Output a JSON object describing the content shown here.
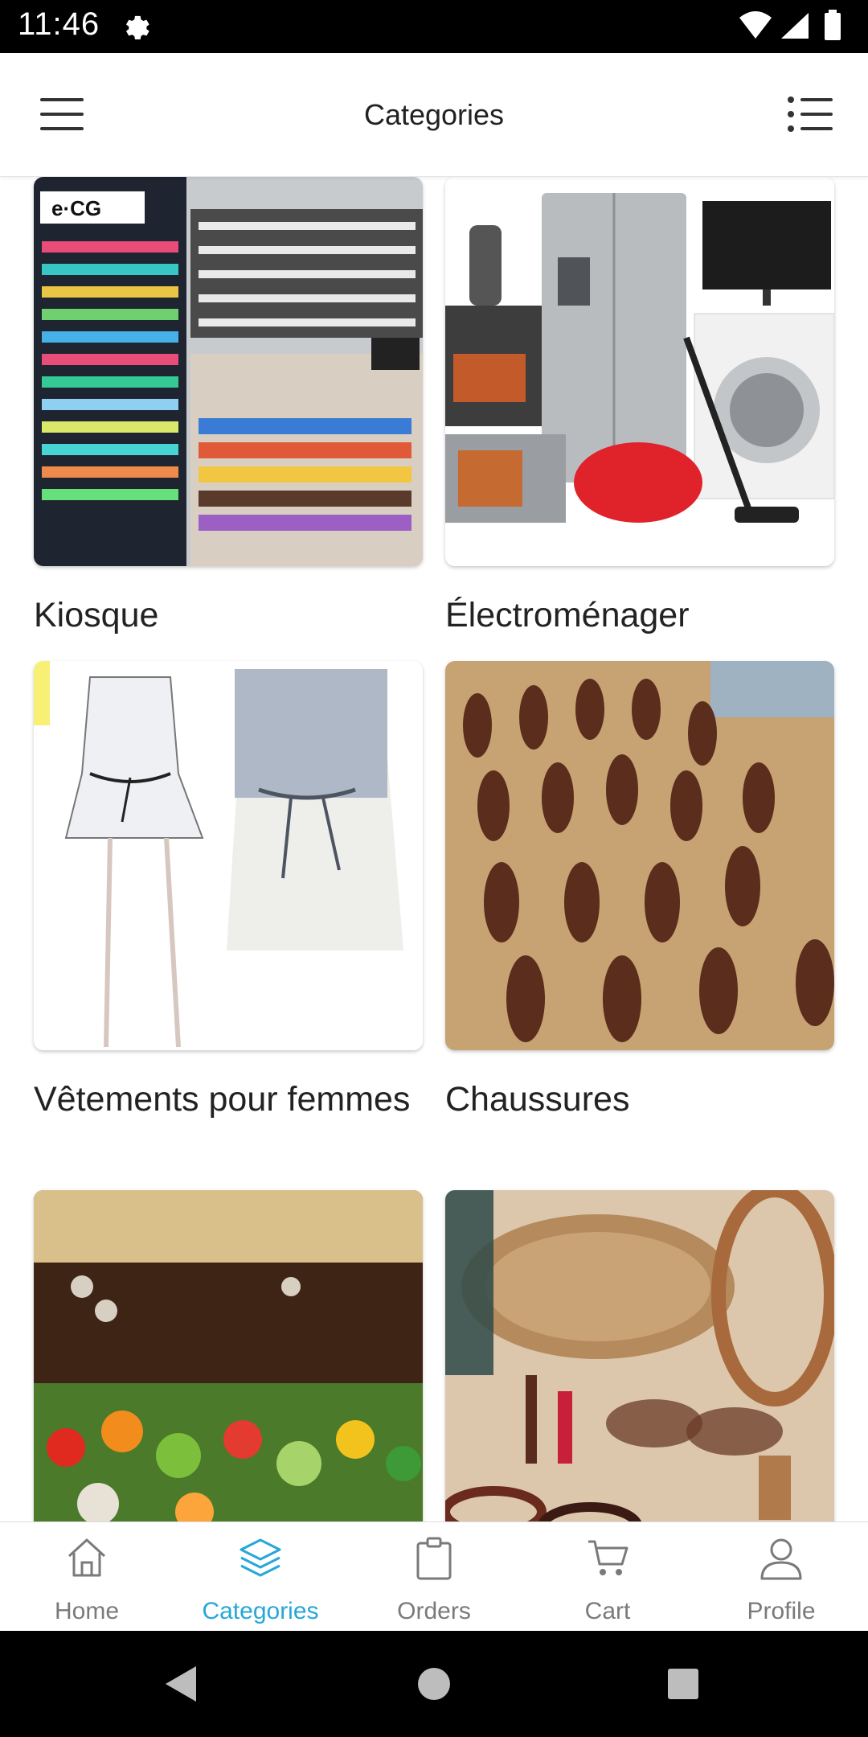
{
  "status": {
    "time": "11:46"
  },
  "header": {
    "title": "Categories"
  },
  "categories": [
    {
      "label": "Kiosque"
    },
    {
      "label": "Électroménager"
    },
    {
      "label": "Vêtements pour femmes"
    },
    {
      "label": "Chaussures"
    },
    {
      "label": ""
    },
    {
      "label": ""
    }
  ],
  "bottom_nav": {
    "items": [
      {
        "label": "Home",
        "icon": "home-icon"
      },
      {
        "label": "Categories",
        "icon": "layers-icon",
        "active": true
      },
      {
        "label": "Orders",
        "icon": "clipboard-icon"
      },
      {
        "label": "Cart",
        "icon": "cart-icon"
      },
      {
        "label": "Profile",
        "icon": "profile-icon"
      }
    ]
  },
  "colors": {
    "accent": "#27a7d8",
    "inactive": "#7a7a7a"
  }
}
